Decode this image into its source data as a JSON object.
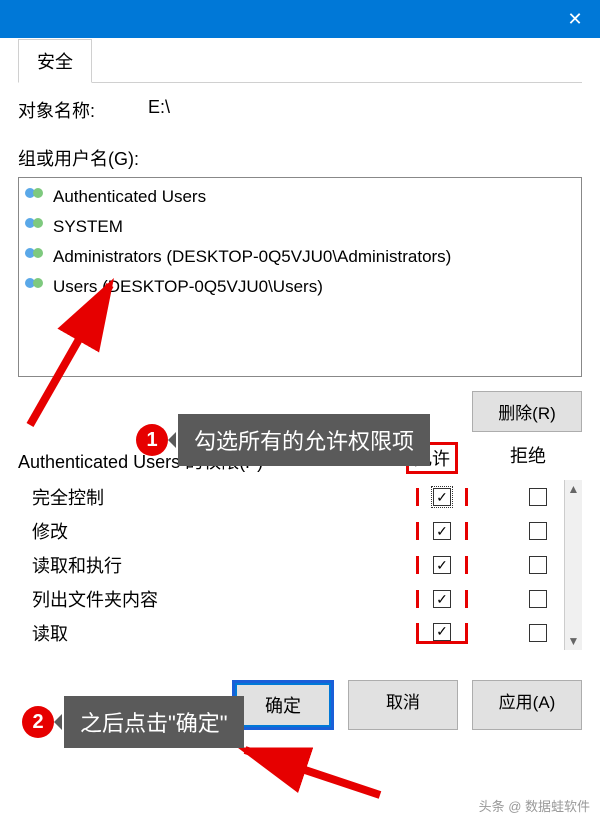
{
  "titlebar": {
    "close": "✕"
  },
  "tab": {
    "label": "安全"
  },
  "object": {
    "label": "对象名称:",
    "value": "E:\\"
  },
  "groups": {
    "label": "组或用户名(G):",
    "items": [
      "Authenticated Users",
      "SYSTEM",
      "Administrators (DESKTOP-0Q5VJU0\\Administrators)",
      "Users (DESKTOP-0Q5VJU0\\Users)"
    ]
  },
  "remove_btn": "删除(R)",
  "perms": {
    "title": "Authenticated Users 的权限(P)",
    "allow": "允许",
    "deny": "拒绝",
    "rows": [
      {
        "name": "完全控制",
        "allow": true,
        "deny": false,
        "focus": true
      },
      {
        "name": "修改",
        "allow": true,
        "deny": false
      },
      {
        "name": "读取和执行",
        "allow": true,
        "deny": false
      },
      {
        "name": "列出文件夹内容",
        "allow": true,
        "deny": false
      },
      {
        "name": "读取",
        "allow": true,
        "deny": false
      }
    ]
  },
  "buttons": {
    "ok": "确定",
    "cancel": "取消",
    "apply": "应用(A)"
  },
  "annot1": {
    "num": "1",
    "text": "勾选所有的允许权限项"
  },
  "annot2": {
    "num": "2",
    "text": "之后点击\"确定\""
  },
  "watermark": "头条 @ 数据蛙软件"
}
